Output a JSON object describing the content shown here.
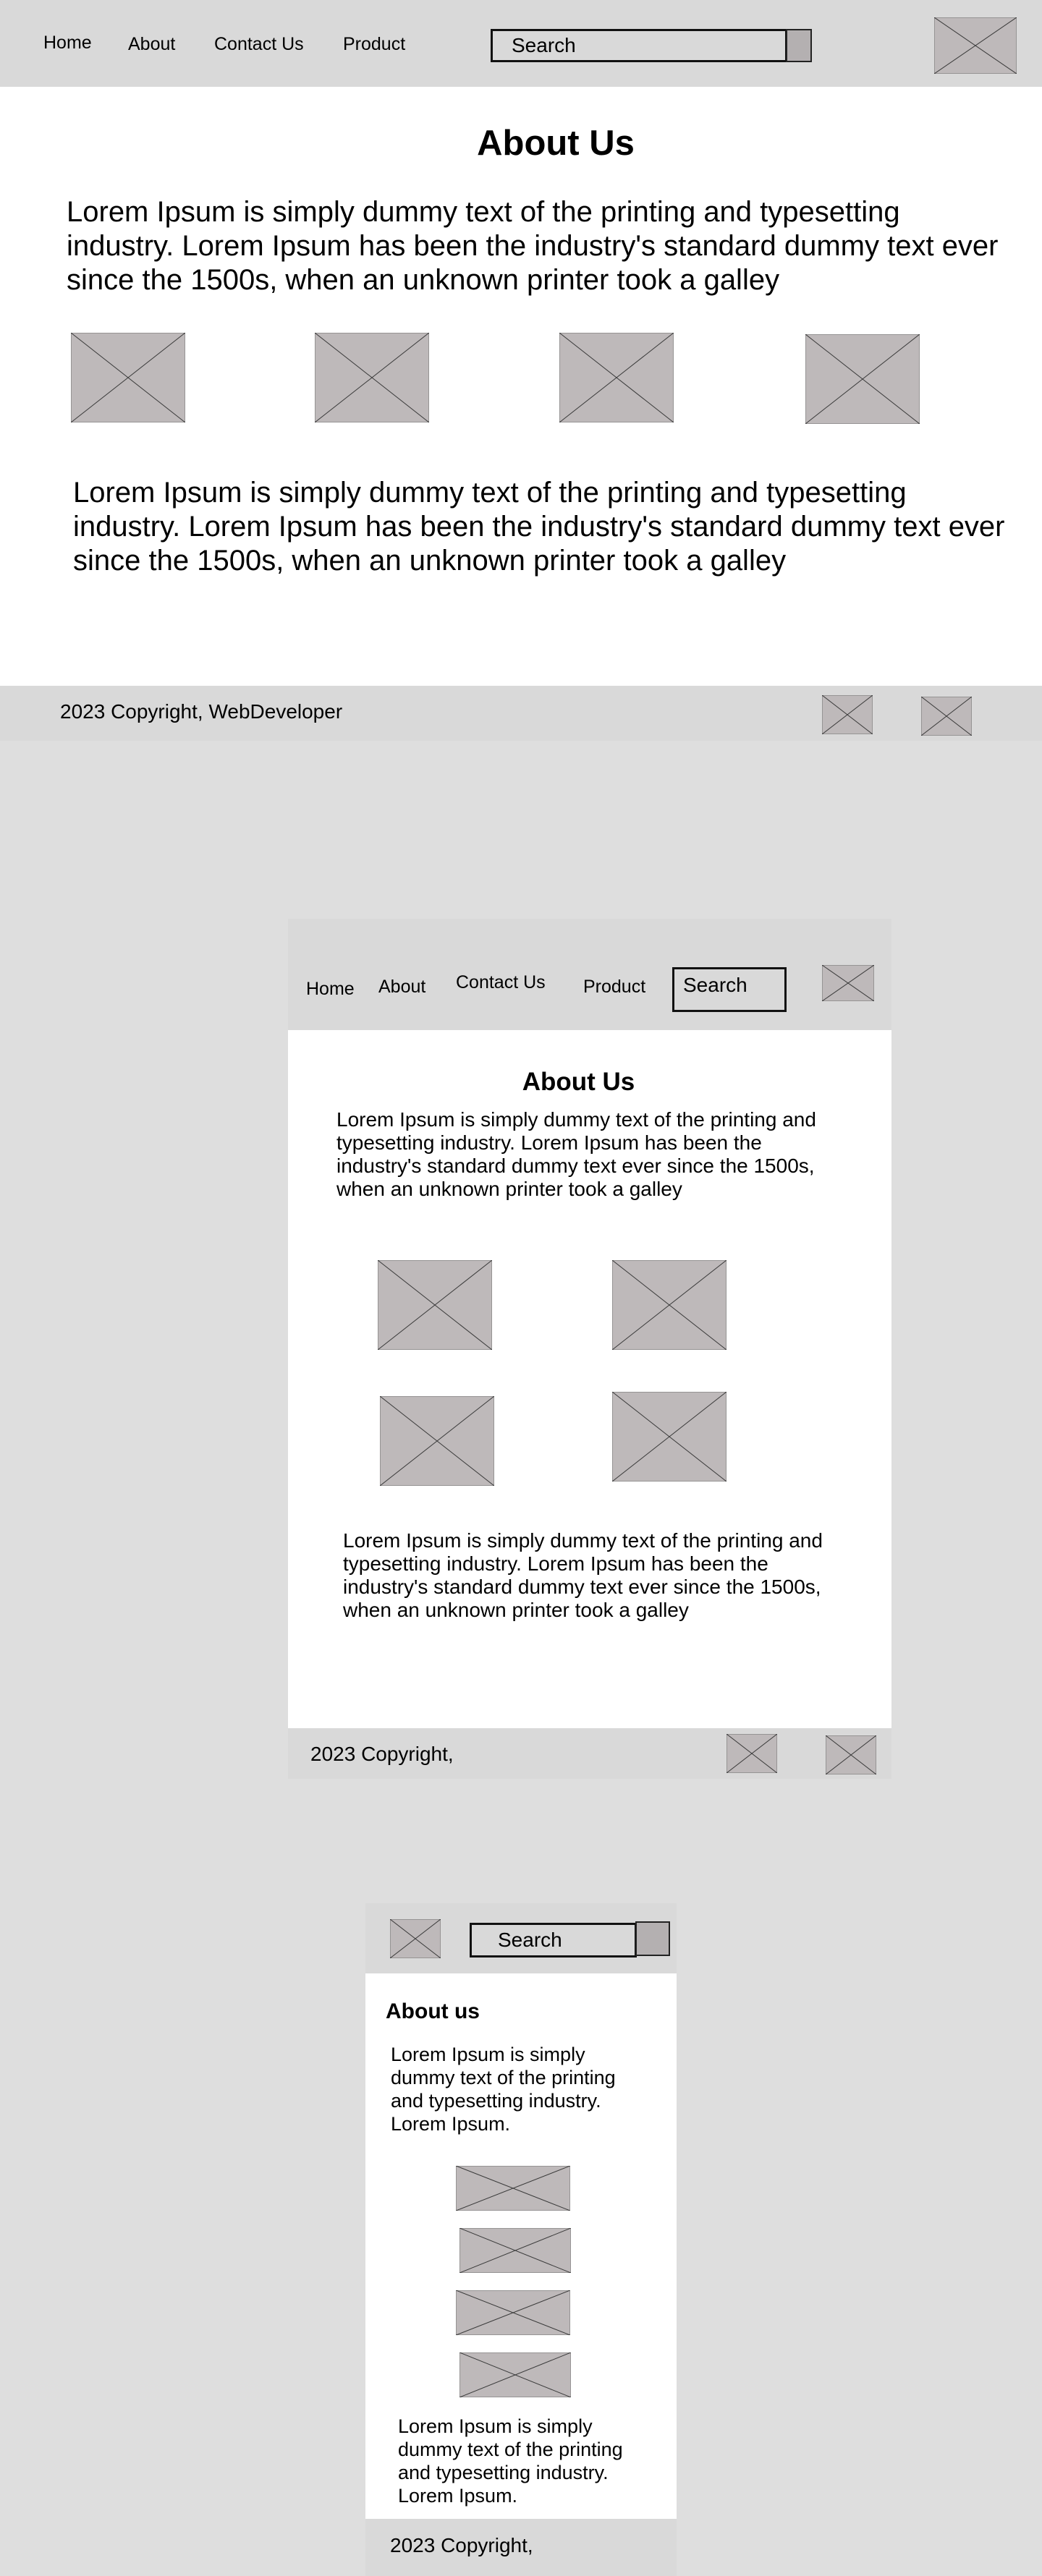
{
  "desktop": {
    "nav": {
      "home": "Home",
      "about": "About",
      "contact": "Contact Us",
      "product": "Product"
    },
    "search": {
      "placeholder": "Search"
    },
    "title": "About Us",
    "paragraph_1": "Lorem Ipsum is simply dummy text of the printing and typesetting industry. Lorem Ipsum has been the industry's standard dummy text ever since the 1500s, when an unknown printer took a galley",
    "paragraph_2": "Lorem Ipsum is simply dummy text of the printing and typesetting industry. Lorem Ipsum has been the industry's standard dummy text ever since the 1500s, when an unknown printer took a galley",
    "footer": {
      "copyright": "2023 Copyright, WebDeveloper"
    }
  },
  "tablet": {
    "nav": {
      "home": "Home",
      "about": "About",
      "contact": "Contact Us",
      "product": "Product"
    },
    "search": {
      "placeholder": "Search"
    },
    "title": "About Us",
    "paragraph_1": "Lorem Ipsum is simply dummy text of the printing and typesetting industry. Lorem Ipsum has been the industry's standard dummy text ever since the 1500s, when an unknown printer took a galley",
    "paragraph_2": "Lorem Ipsum is simply dummy text of the printing and typesetting industry. Lorem Ipsum has been the industry's standard dummy text ever since the 1500s, when an unknown printer took a galley",
    "footer": {
      "copyright": "2023 Copyright,"
    }
  },
  "mobile": {
    "search": {
      "placeholder": "Search"
    },
    "title": "About us",
    "paragraph_1": "Lorem Ipsum is simply dummy text of the printing and typesetting industry. Lorem Ipsum.",
    "paragraph_2": "Lorem Ipsum is simply dummy text of the printing and typesetting industry. Lorem Ipsum.",
    "footer": {
      "copyright": "2023 Copyright,"
    }
  },
  "colors": {
    "page_background": "#dedede",
    "bar_background": "#d9d9d9",
    "content_background": "#ffffff",
    "placeholder_fill": "#beb9ba"
  },
  "icons": [
    "image-placeholder-icon"
  ]
}
